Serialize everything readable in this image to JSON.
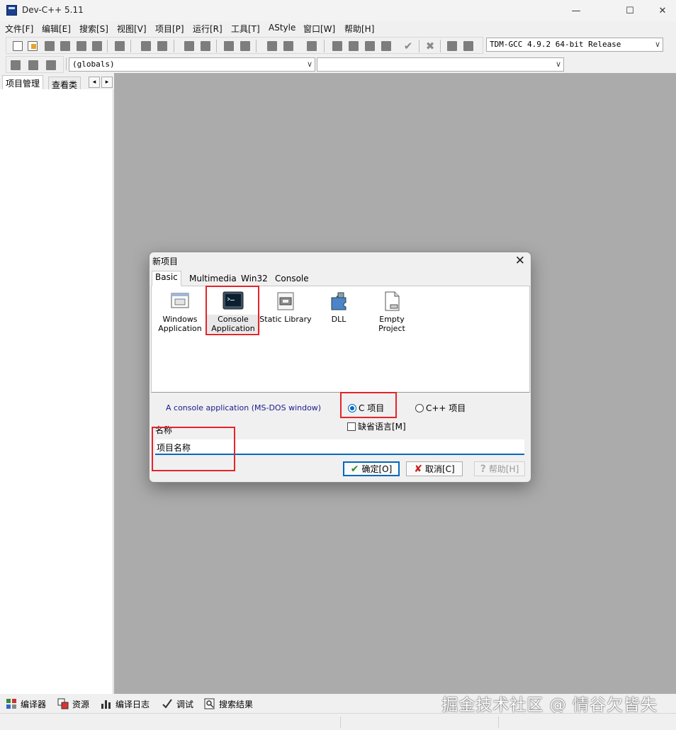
{
  "window": {
    "title": "Dev-C++ 5.11",
    "minimize_glyph": "—",
    "maximize_glyph": "☐",
    "close_glyph": "✕"
  },
  "menu": [
    "文件[F]",
    "编辑[E]",
    "搜索[S]",
    "视图[V]",
    "项目[P]",
    "运行[R]",
    "工具[T]",
    "AStyle",
    "窗口[W]",
    "帮助[H]"
  ],
  "toolbar": {
    "compiler_combo": "TDM-GCC 4.9.2 64-bit Release",
    "scope_combo": "(globals)",
    "member_combo": ""
  },
  "left_panel": {
    "tabs": [
      "项目管理",
      "查看类"
    ],
    "scroll_left": "◂",
    "scroll_right": "▸"
  },
  "bottom_tabs": [
    "编译器",
    "资源",
    "编译日志",
    "调试",
    "搜索结果"
  ],
  "watermark": "掘金技术社区 @ 情谷欠皆失",
  "dialog": {
    "title": "新项目",
    "close_glyph": "✕",
    "tabs": [
      "Basic",
      "Multimedia",
      "Win32",
      "Console"
    ],
    "templates": [
      {
        "line1": "Windows",
        "line2": "Application",
        "icon": "window-icon"
      },
      {
        "line1": "Console",
        "line2": "Application",
        "icon": "console-icon"
      },
      {
        "line1": "Static Library",
        "line2": "",
        "icon": "library-icon"
      },
      {
        "line1": "DLL",
        "line2": "",
        "icon": "puzzle-icon"
      },
      {
        "line1": "Empty Project",
        "line2": "",
        "icon": "empty-project-icon"
      }
    ],
    "description": "A console application (MS-DOS window)",
    "radio_c": "C 项目",
    "radio_cpp": "C++ 项目",
    "selected_language": "C",
    "default_language_label": "缺省语言[M]",
    "default_language_checked": false,
    "name_label": "名称",
    "name_value": "项目名称",
    "ok_label": "确定[O]",
    "cancel_label": "取消[C]",
    "help_label": "帮助[H]",
    "ok_glyph": "✔",
    "cancel_glyph": "✘",
    "help_glyph": "?"
  },
  "colors": {
    "accent": "#0067c0",
    "highlight_box": "#e4242b",
    "workspace": "#ababab"
  }
}
